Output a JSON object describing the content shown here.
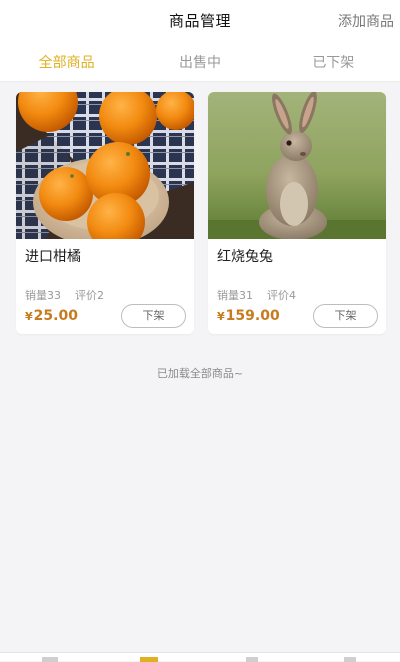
{
  "header": {
    "title": "商品管理",
    "action_label": "添加商品"
  },
  "tabs": [
    {
      "label": "全部商品",
      "active": true
    },
    {
      "label": "出售中",
      "active": false
    },
    {
      "label": "已下架",
      "active": false
    }
  ],
  "products": [
    {
      "name": "进口柑橘",
      "sales": "销量33",
      "reviews": "评价2",
      "currency": "¥",
      "price": "25.00",
      "button": "下架",
      "image": "oranges-photo"
    },
    {
      "name": "红烧兔兔",
      "sales": "销量31",
      "reviews": "评价4",
      "currency": "¥",
      "price": "159.00",
      "button": "下架",
      "image": "rabbit-photo"
    }
  ],
  "footer_note": "已加载全部商品~",
  "colors": {
    "accent": "#e0b020",
    "price": "#c77b1e",
    "background": "#f4f4f6"
  }
}
